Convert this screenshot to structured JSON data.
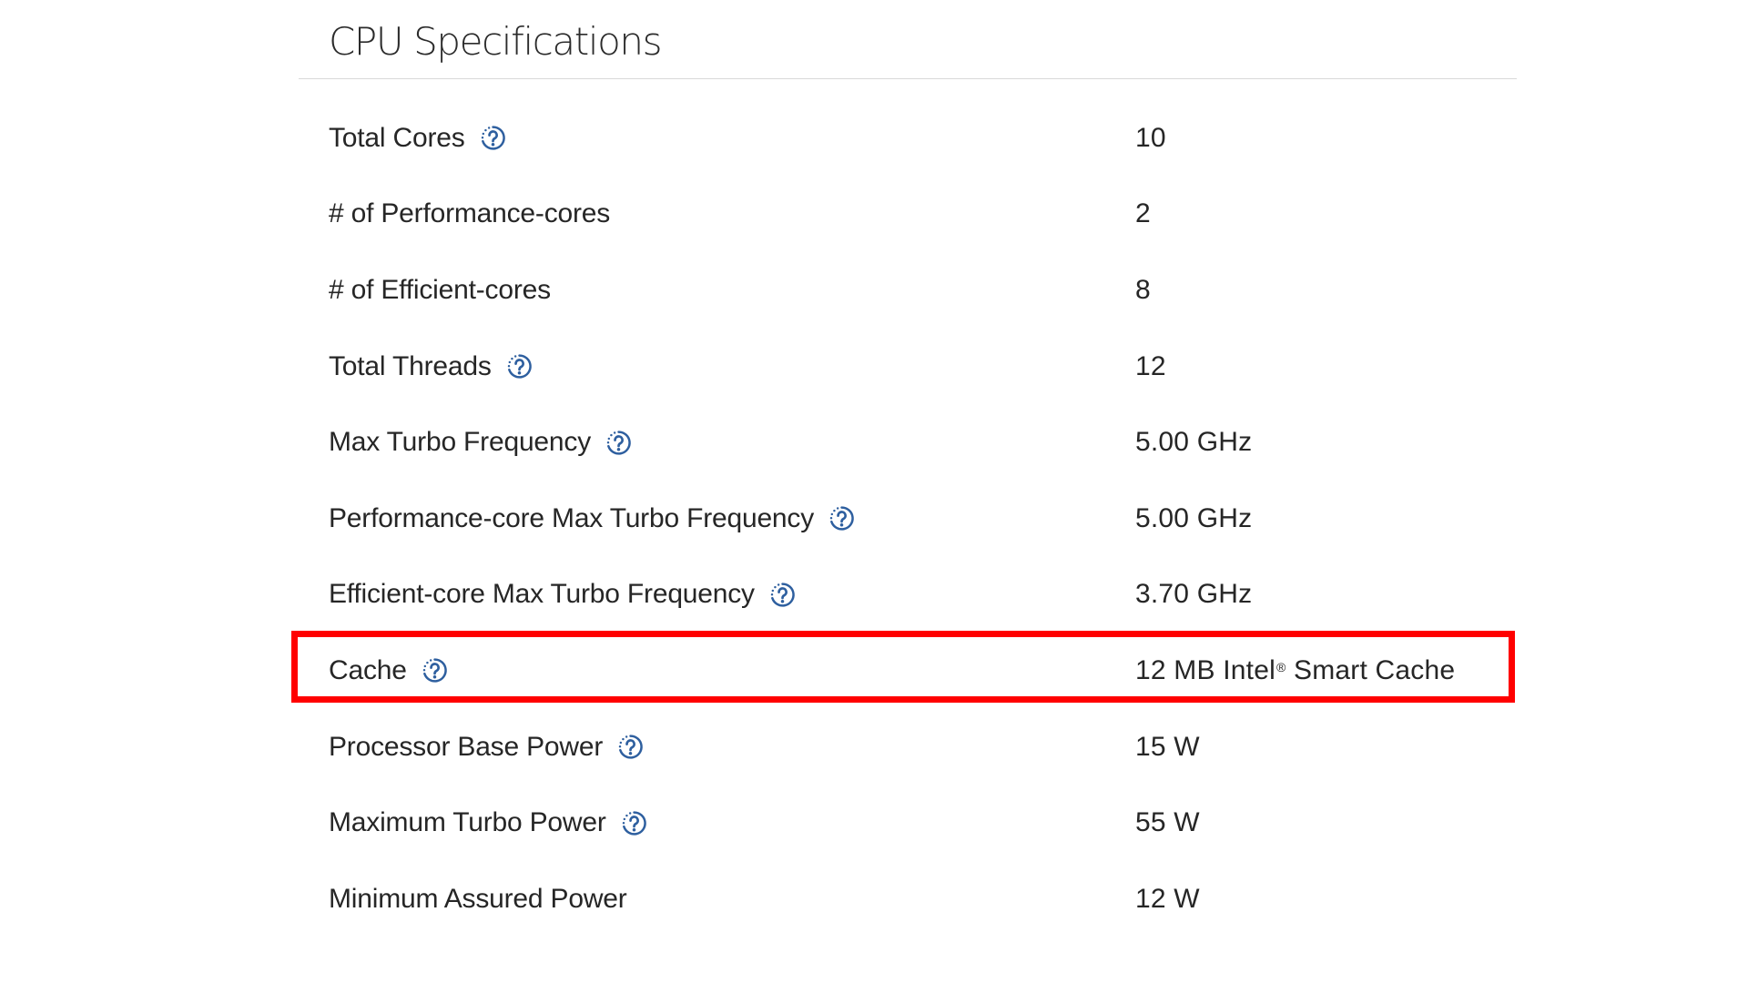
{
  "section": {
    "title": "CPU Specifications"
  },
  "specs": [
    {
      "label": "Total Cores",
      "value": "10",
      "help": true
    },
    {
      "label": "# of Performance-cores",
      "value": "2",
      "help": false
    },
    {
      "label": "# of Efficient-cores",
      "value": "8",
      "help": false
    },
    {
      "label": "Total Threads",
      "value": "12",
      "help": true
    },
    {
      "label": "Max Turbo Frequency",
      "value": "5.00 GHz",
      "help": true
    },
    {
      "label": "Performance-core Max Turbo Frequency",
      "value": "5.00 GHz",
      "help": true
    },
    {
      "label": "Efficient-core Max Turbo Frequency",
      "value": "3.70 GHz",
      "help": true
    },
    {
      "label": "Cache",
      "value": "12 MB Intel",
      "value_sup": "®",
      "value_suffix": " Smart Cache",
      "help": true,
      "highlighted": true
    },
    {
      "label": "Processor Base Power",
      "value": "15 W",
      "help": true
    },
    {
      "label": "Maximum Turbo Power",
      "value": "55 W",
      "help": true
    },
    {
      "label": "Minimum Assured Power",
      "value": "12 W",
      "help": false
    }
  ],
  "icons": {
    "help": "question-circle-icon"
  },
  "colors": {
    "text": "#262626",
    "help_icon": "#2e5f9f",
    "highlight": "#ff0000",
    "divider": "#d9d9d9"
  }
}
